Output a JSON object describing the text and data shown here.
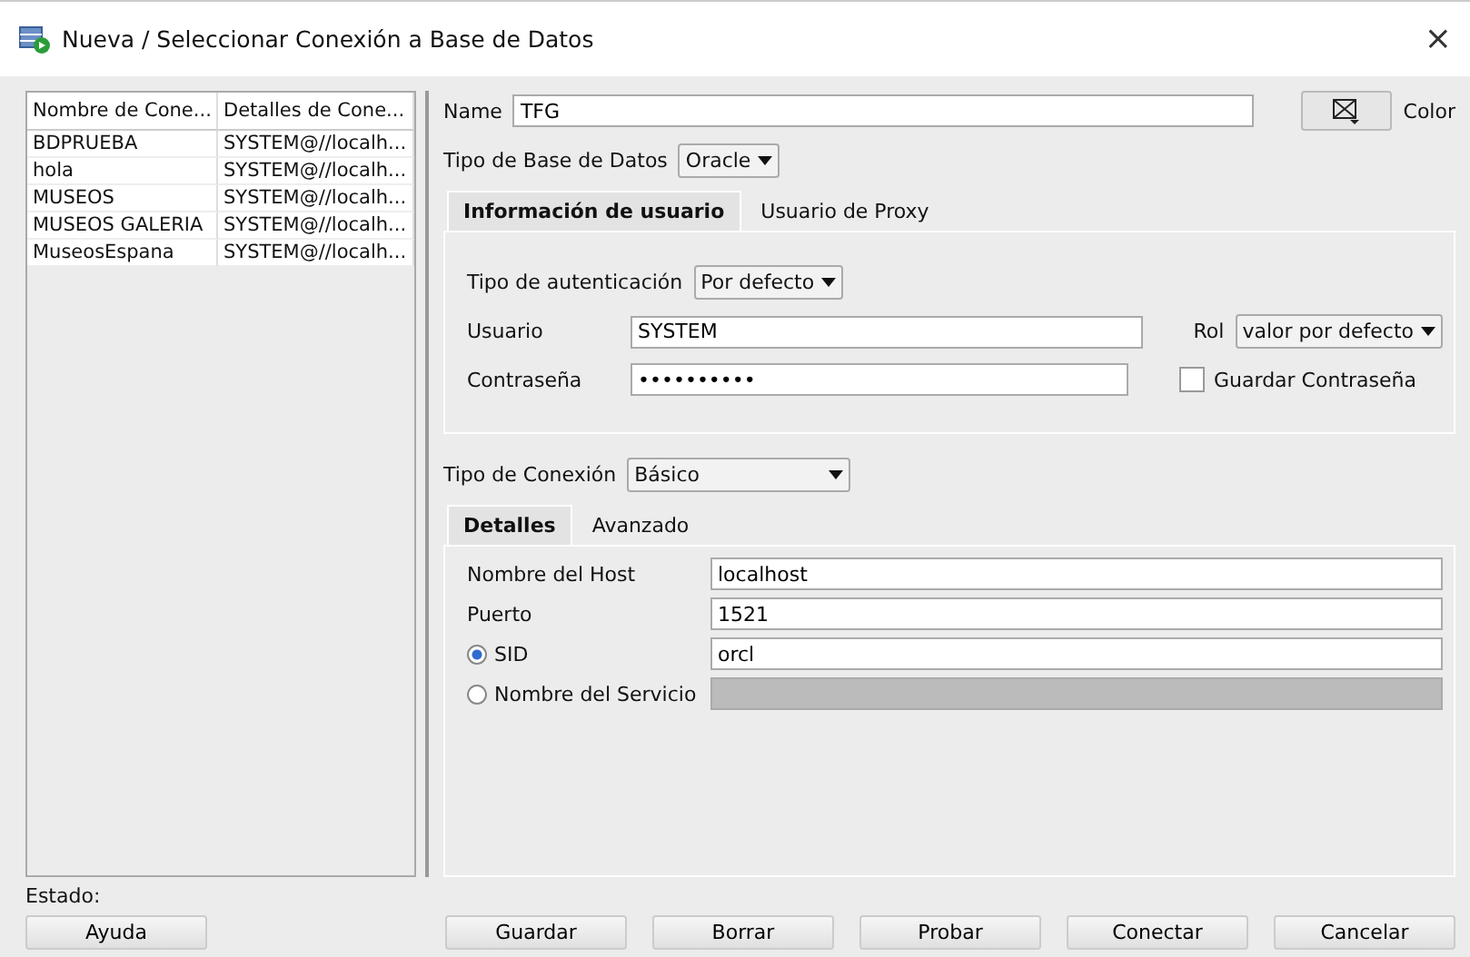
{
  "window": {
    "title": "Nueva / Seleccionar Conexión a Base de Datos",
    "close": "×"
  },
  "connections": {
    "columns": [
      "Nombre de Cone...",
      "Detalles de Cone..."
    ],
    "rows": [
      {
        "cells": [
          "BDPRUEBA",
          "SYSTEM@//localh..."
        ]
      },
      {
        "cells": [
          "hola",
          "SYSTEM@//localh..."
        ]
      },
      {
        "cells": [
          "MUSEOS",
          "SYSTEM@//localh..."
        ]
      },
      {
        "cells": [
          "MUSEOS GALERIA",
          "SYSTEM@//localh..."
        ]
      },
      {
        "cells": [
          "MuseosEspana",
          "SYSTEM@//localh..."
        ]
      }
    ]
  },
  "name": {
    "label": "Name",
    "value": "TFG"
  },
  "color": {
    "label": "Color"
  },
  "db_type": {
    "label": "Tipo de Base de Datos",
    "value": "Oracle"
  },
  "tabs": [
    {
      "label": "Información de usuario",
      "selected": true
    },
    {
      "label": "Usuario de Proxy",
      "selected": false
    }
  ],
  "auth": {
    "label": "Tipo de autenticación",
    "value": "Por defecto"
  },
  "user": {
    "label": "Usuario",
    "value": "SYSTEM"
  },
  "role": {
    "label": "Rol",
    "value": "valor por defecto"
  },
  "password": {
    "label": "Contraseña",
    "value": "••••••••••"
  },
  "save_password": {
    "label": "Guardar Contraseña",
    "checked": false
  },
  "connection_type": {
    "label": "Tipo de Conexión",
    "value": "Básico"
  },
  "detail_tabs": [
    {
      "label": "Detalles",
      "selected": true
    },
    {
      "label": "Avanzado",
      "selected": false
    }
  ],
  "details": [
    {
      "kind": "field",
      "label": "Nombre del Host",
      "value": "localhost",
      "disabled": false
    },
    {
      "kind": "field",
      "label": "Puerto",
      "value": "1521",
      "disabled": false
    },
    {
      "kind": "radio",
      "label": "SID",
      "value": "orcl",
      "selected": true,
      "disabled": false
    },
    {
      "kind": "radio",
      "label": "Nombre del Servicio",
      "selected": false,
      "disabled": true
    }
  ],
  "status": {
    "label": "Estado:"
  },
  "buttons": [
    {
      "label": "Ayuda"
    },
    {
      "label": "Guardar"
    },
    {
      "label": "Borrar"
    },
    {
      "label": "Probar"
    },
    {
      "label": "Conectar"
    },
    {
      "label": "Cancelar"
    }
  ]
}
